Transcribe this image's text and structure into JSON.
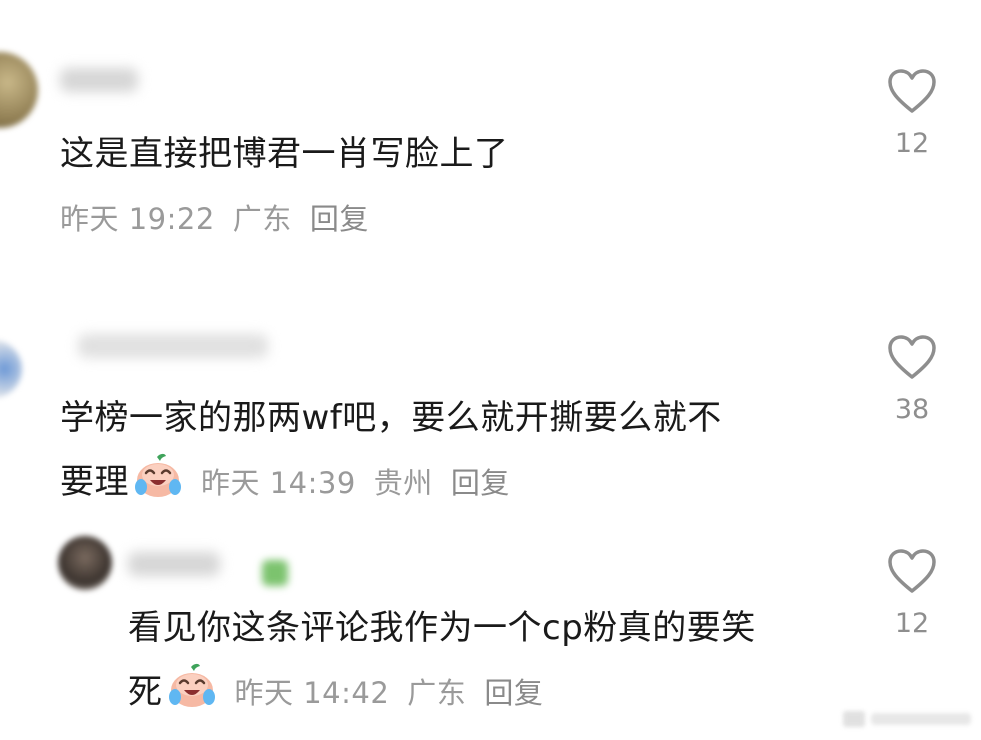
{
  "comments": [
    {
      "text": "这是直接把博君一肖写脸上了",
      "time": "昨天 19:22",
      "location": "广东",
      "reply_label": "回复",
      "likes": "12"
    },
    {
      "text_line1": "学榜一家的那两wf吧，要么就开撕要么就不",
      "text_line2": "要理",
      "time": "昨天 14:39",
      "location": "贵州",
      "reply_label": "回复",
      "likes": "38"
    },
    {
      "text_line1": "看见你这条评论我作为一个cp粉真的要笑",
      "text_line2": "死",
      "time": "昨天 14:42",
      "location": "广东",
      "reply_label": "回复",
      "likes": "12"
    }
  ],
  "icons": {
    "like": "heart-outline-icon",
    "emoji": "laugh-cry-emoji-icon"
  },
  "colors": {
    "text": "#1a1a1a",
    "meta": "#9a9a9a",
    "like_stroke": "#8e8e8e"
  }
}
